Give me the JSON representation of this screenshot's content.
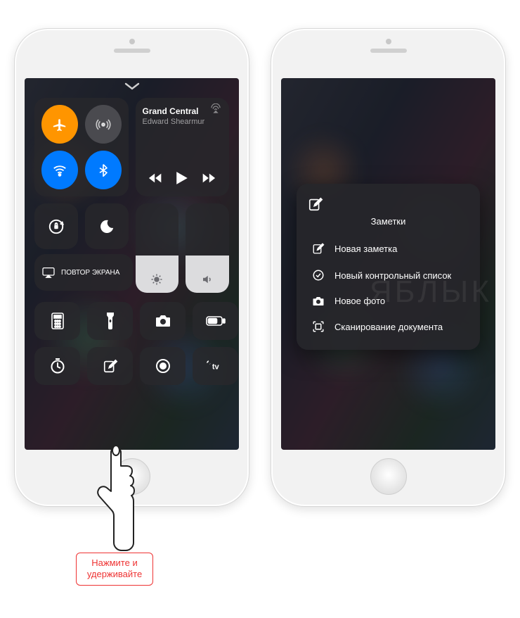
{
  "media": {
    "title": "Grand Central",
    "artist": "Edward Shearmur"
  },
  "mirror_label": "ПОВТОР ЭКРАНА",
  "notes": {
    "title": "Заметки",
    "items": [
      "Новая заметка",
      "Новый контрольный список",
      "Новое фото",
      "Сканирование документа"
    ]
  },
  "hint": "Нажмите и удерживайте",
  "watermark": "ЯБЛЫК",
  "connectivity": {
    "airplane_on": true,
    "cellular_on": false,
    "wifi_on": true,
    "bluetooth_on": true
  },
  "sliders": {
    "brightness_pct": 42,
    "volume_pct": 42
  }
}
